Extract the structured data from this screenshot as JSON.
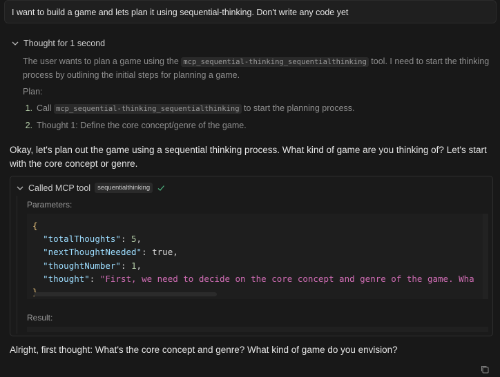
{
  "user_message": "I want to build a game and lets plan it using sequential-thinking. Don't write any code yet",
  "thought": {
    "header": "Thought for 1 second",
    "p1_pre": "The user wants to plan a game using the ",
    "p1_code": "mcp_sequential-thinking_sequentialthinking",
    "p1_post": " tool. I need to start the thinking process by outlining the initial steps for planning a game.",
    "plan_label": "Plan:",
    "plan": [
      {
        "num": "1.",
        "pre": "Call ",
        "code": "mcp_sequential-thinking_sequentialthinking",
        "post": " to start the planning process."
      },
      {
        "num": "2.",
        "pre": "Thought 1: Define the core concept/genre of the game.",
        "code": "",
        "post": ""
      }
    ]
  },
  "reply": "Okay, let's plan out the game using a sequential thinking process. What kind of game are you thinking of? Let's start with the core concept or genre.",
  "tool": {
    "header": "Called MCP tool",
    "badge": "sequentialthinking",
    "params_label": "Parameters:",
    "code": {
      "open": "{",
      "k1": "\"totalThoughts\"",
      "v1": "5",
      "k2": "\"nextThoughtNeeded\"",
      "v2": "true",
      "k3": "\"thoughtNumber\"",
      "v3": "1",
      "k4": "\"thought\"",
      "v4": "\"First, we need to decide on the core concept and genre of the game. Wha",
      "close": "}"
    },
    "result_label": "Result:"
  },
  "final_message": "Alright, first thought: What's the core concept and genre? What kind of game do you envision?",
  "icons": [
    "chevron-down-icon",
    "check-icon",
    "copy-icon"
  ],
  "colors": {
    "background": "#181818",
    "check": "#4caf7d",
    "json_key": "#9cdcfe",
    "json_string": "#d16db5",
    "brace": "#e5c07b"
  }
}
